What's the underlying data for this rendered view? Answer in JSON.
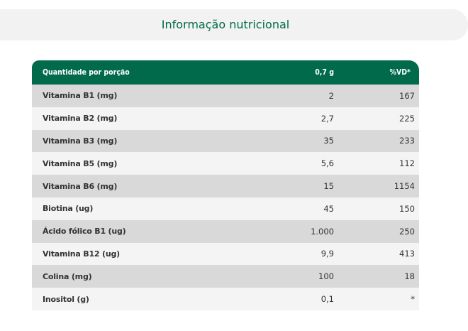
{
  "title": "Informação nutricional",
  "table": {
    "headers": {
      "name": "Quantidade por porção",
      "qty": "0,7 g",
      "vd": "%VD*"
    },
    "rows": [
      {
        "name": "Vitamina B1 (mg)",
        "qty": "2",
        "vd": "167"
      },
      {
        "name": "Vitamina B2 (mg)",
        "qty": "2,7",
        "vd": "225"
      },
      {
        "name": "Vitamina B3 (mg)",
        "qty": "35",
        "vd": "233"
      },
      {
        "name": "Vitamina B5 (mg)",
        "qty": "5,6",
        "vd": "112"
      },
      {
        "name": "Vitamina B6 (mg)",
        "qty": "15",
        "vd": "1154"
      },
      {
        "name": "Biotina (ug)",
        "qty": "45",
        "vd": "150"
      },
      {
        "name": "Ácido fólico B1 (ug)",
        "qty": "1.000",
        "vd": "250"
      },
      {
        "name": "Vitamina B12 (ug)",
        "qty": "9,9",
        "vd": "413"
      },
      {
        "name": "Colina (mg)",
        "qty": "100",
        "vd": "18"
      },
      {
        "name": "Inositol (g)",
        "qty": "0,1",
        "vd": "*"
      }
    ]
  },
  "colors": {
    "accent": "#006a4a",
    "row_dark": "#d9d9d9",
    "row_light": "#f4f4f4",
    "title_bar": "#f2f2f2"
  }
}
